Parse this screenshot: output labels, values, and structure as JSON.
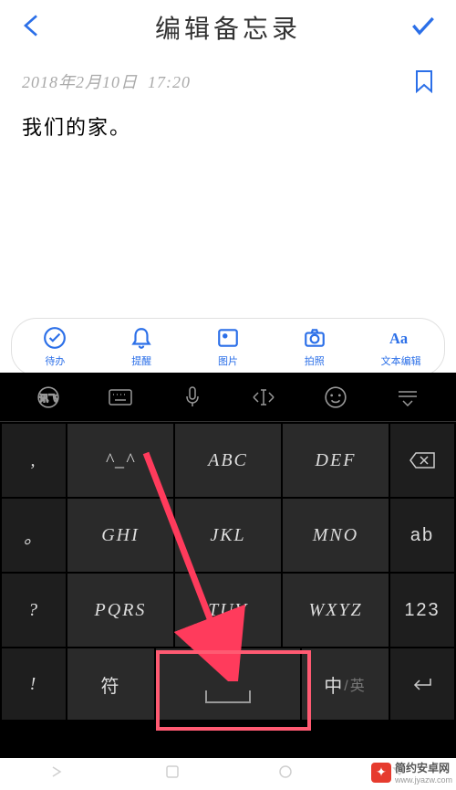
{
  "header": {
    "title": "编辑备忘录"
  },
  "memo": {
    "date": "2018年2月10日",
    "time": "17:20",
    "content": "我们的家。"
  },
  "toolbar": {
    "items": [
      {
        "label": "待办"
      },
      {
        "label": "提醒"
      },
      {
        "label": "图片"
      },
      {
        "label": "拍照"
      },
      {
        "label": "文本编辑"
      }
    ]
  },
  "keyboard": {
    "sideLeft": [
      ",",
      "。",
      "?",
      "!"
    ],
    "row1": [
      "^_^",
      "ABC",
      "DEF"
    ],
    "row2": [
      "GHI",
      "JKL",
      "MNO"
    ],
    "row3": [
      "PQRS",
      "TUV",
      "WXYZ"
    ],
    "sideRight": [
      "",
      "ab",
      "123",
      ""
    ],
    "bottom": {
      "symbol": "符",
      "langMain": "中",
      "langAlt": "/英"
    }
  },
  "watermark": {
    "text": "简约安卓网",
    "url": "www.jyazw.com"
  }
}
